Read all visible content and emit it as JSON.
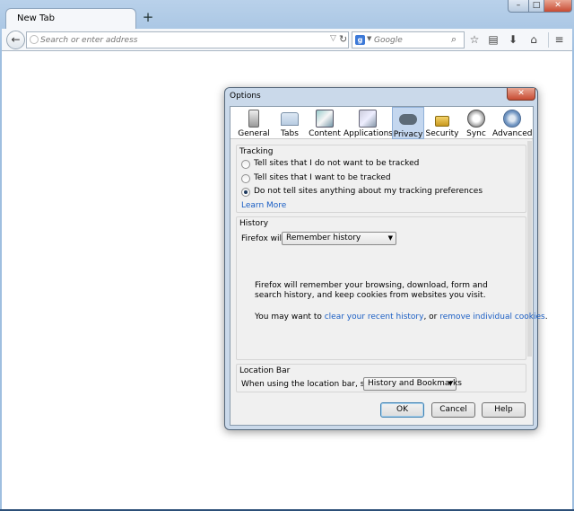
{
  "browser": {
    "tab_title": "New Tab",
    "new_tab_symbol": "+",
    "window_controls": {
      "minimize": "–",
      "maximize": "□",
      "close": "✕"
    },
    "url_placeholder": "Search or enter address",
    "search_engine_label": "g",
    "search_placeholder": "Google",
    "toolbar_icons": [
      "star-icon",
      "bookmarks-menu-icon",
      "download-icon",
      "home-icon",
      "menu-icon"
    ]
  },
  "dialog": {
    "title": "Options",
    "close_symbol": "✕",
    "panes": [
      {
        "id": "general",
        "label": "General",
        "icon": "general-icon"
      },
      {
        "id": "tabs",
        "label": "Tabs",
        "icon": "tabs-icon"
      },
      {
        "id": "content",
        "label": "Content",
        "icon": "content-icon"
      },
      {
        "id": "applications",
        "label": "Applications",
        "icon": "applications-icon"
      },
      {
        "id": "privacy",
        "label": "Privacy",
        "icon": "privacy-mask-icon",
        "selected": true
      },
      {
        "id": "security",
        "label": "Security",
        "icon": "padlock-icon"
      },
      {
        "id": "sync",
        "label": "Sync",
        "icon": "sync-icon"
      },
      {
        "id": "advanced",
        "label": "Advanced",
        "icon": "advanced-gear-icon"
      }
    ],
    "tracking": {
      "title": "Tracking",
      "options": [
        {
          "label": "Tell sites that I do not want to be tracked",
          "checked": false
        },
        {
          "label": "Tell sites that I want to be tracked",
          "checked": false
        },
        {
          "label": "Do not tell sites anything about my tracking preferences",
          "checked": true
        }
      ],
      "learn_more": "Learn More"
    },
    "history": {
      "title": "History",
      "firefox_will_label": "Firefox will:",
      "mode_value": "Remember history",
      "description": "Firefox will remember your browsing, download, form and search history, and keep cookies from websites you visit.",
      "may_want_prefix": "You may want to ",
      "clear_link": "clear your recent history",
      "separator": ", or ",
      "remove_link": "remove individual cookies",
      "suffix": "."
    },
    "location_bar": {
      "title": "Location Bar",
      "suggest_label": "When using the location bar, suggest:",
      "suggest_value": "History and Bookmarks"
    },
    "buttons": {
      "ok": "OK",
      "cancel": "Cancel",
      "help": "Help"
    }
  }
}
